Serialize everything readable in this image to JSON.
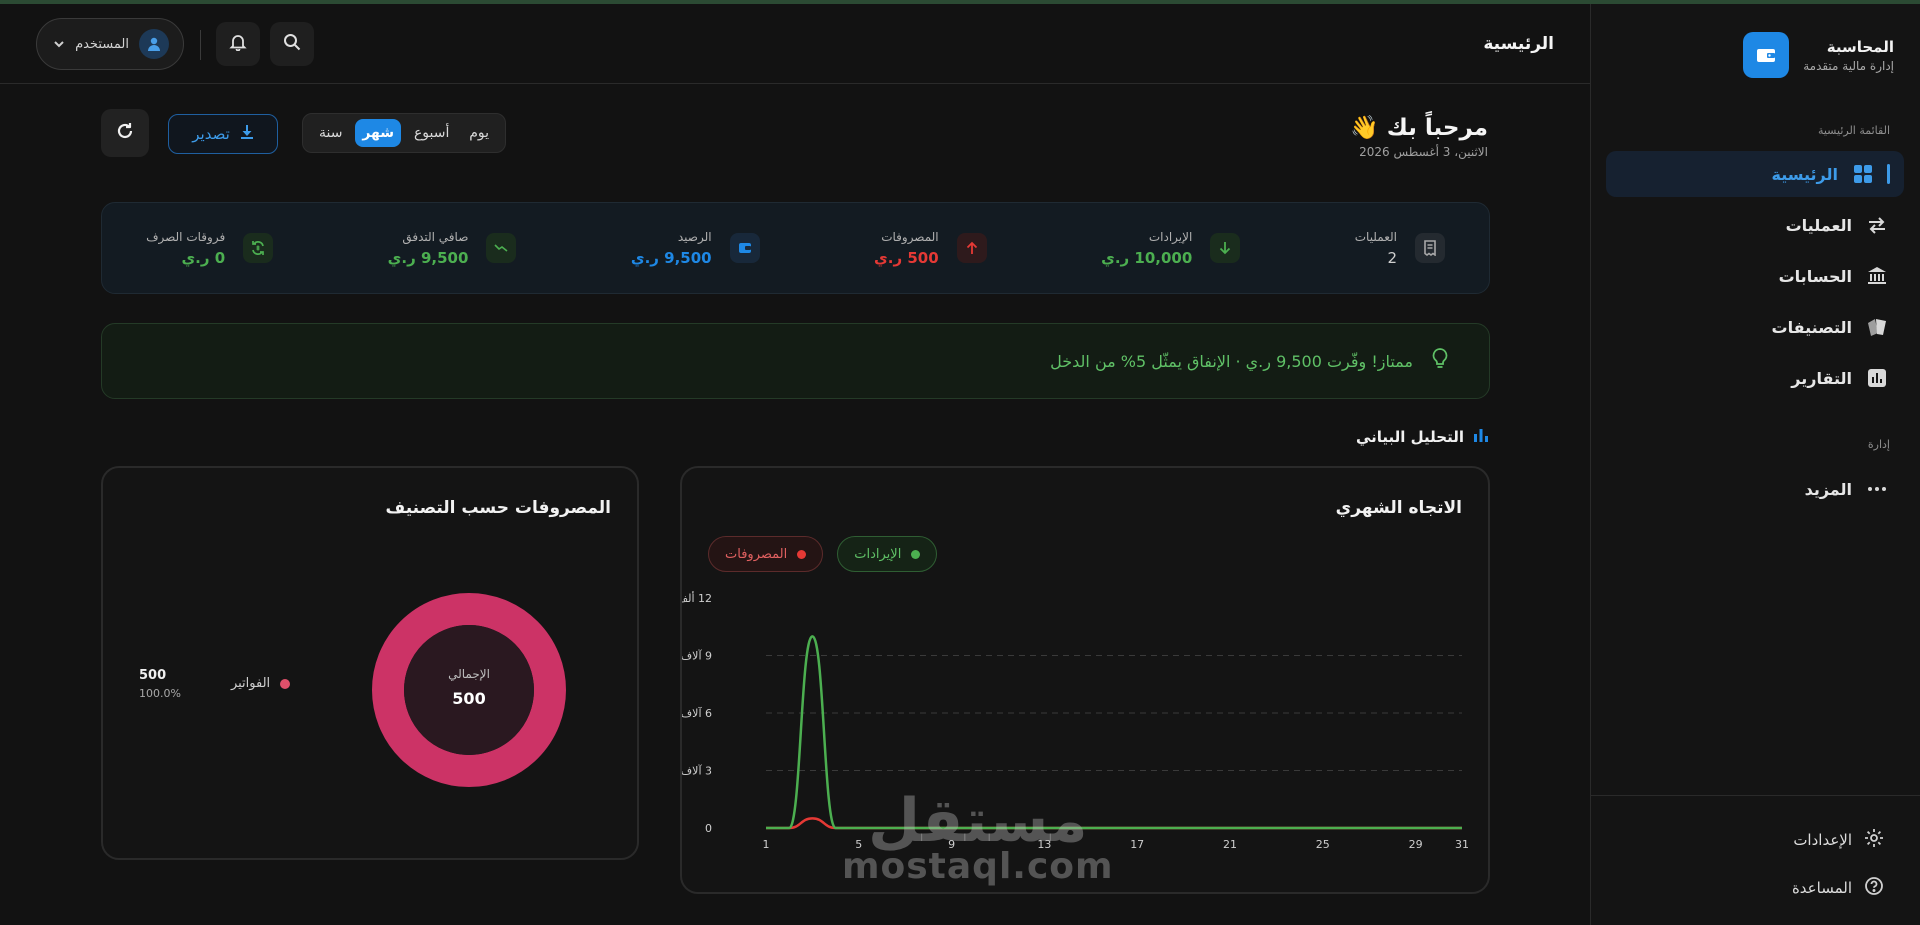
{
  "brand": {
    "title": "المحاسبة",
    "subtitle": "إدارة مالية متقدمة"
  },
  "sidebar": {
    "main_section": "القائمة الرئيسية",
    "items": [
      {
        "label": "الرئيسية",
        "icon": "grid-icon",
        "active": true
      },
      {
        "label": "العمليات",
        "icon": "swap-arrows-icon"
      },
      {
        "label": "الحسابات",
        "icon": "bank-icon"
      },
      {
        "label": "التصنيفات",
        "icon": "tags-icon"
      },
      {
        "label": "التقارير",
        "icon": "bar-chart-icon"
      }
    ],
    "admin_section": "إدارة",
    "more_label": "المزيد",
    "settings_label": "الإعدادات",
    "help_label": "المساعدة"
  },
  "header": {
    "page_title": "الرئيسية",
    "user_label": "المستخدم"
  },
  "welcome": {
    "title": "مرحباً بك 👋",
    "date": "الاثنين، 3 أغسطس 2026"
  },
  "period": {
    "options": [
      "يوم",
      "أسبوع",
      "شهر",
      "سنة"
    ],
    "selected": "شهر"
  },
  "actions": {
    "export_label": "تصدير"
  },
  "stats": [
    {
      "label": "العمليات",
      "value": "2",
      "color": "#cfcfcf",
      "icon": "receipt-icon"
    },
    {
      "label": "الإيرادات",
      "value": "10,000 ر.ي",
      "color": "#4caf50",
      "icon": "arrow-down-icon"
    },
    {
      "label": "المصروفات",
      "value": "500 ر.ي",
      "color": "#e53935",
      "icon": "arrow-up-icon"
    },
    {
      "label": "الرصيد",
      "value": "9,500 ر.ي",
      "color": "#1e88e5",
      "icon": "wallet-icon"
    },
    {
      "label": "صافي التدفق",
      "value": "9,500 ر.ي",
      "color": "#4caf50",
      "icon": "trend-icon"
    },
    {
      "label": "فروقات الصرف",
      "value": "0 ر.ي",
      "color": "#4caf50",
      "icon": "exchange-icon"
    }
  ],
  "insight": {
    "text": "ممتاز! وفّرت 9,500 ر.ي · الإنفاق يمثّل 5% من الدخل"
  },
  "analytics": {
    "section_title": "التحليل البياني"
  },
  "chart_data": [
    {
      "type": "line",
      "title": "الاتجاه الشهري",
      "x": [
        1,
        2,
        3,
        4,
        5,
        6,
        7,
        8,
        9,
        10,
        11,
        12,
        13,
        14,
        15,
        16,
        17,
        18,
        19,
        20,
        21,
        22,
        23,
        24,
        25,
        26,
        27,
        28,
        29,
        30,
        31
      ],
      "x_tick_labels": [
        "1",
        "5",
        "9",
        "13",
        "17",
        "21",
        "25",
        "29",
        "31"
      ],
      "y_tick_labels": [
        "0",
        "3 آلاف",
        "6 آلاف",
        "9 آلاف",
        "12 ألف"
      ],
      "ylim": [
        0,
        12000
      ],
      "series": [
        {
          "name": "الإيرادات",
          "color": "#4caf50",
          "values": [
            0,
            0,
            10000,
            0,
            0,
            0,
            0,
            0,
            0,
            0,
            0,
            0,
            0,
            0,
            0,
            0,
            0,
            0,
            0,
            0,
            0,
            0,
            0,
            0,
            0,
            0,
            0,
            0,
            0,
            0,
            0
          ]
        },
        {
          "name": "المصروفات",
          "color": "#e53935",
          "values": [
            0,
            0,
            500,
            0,
            0,
            0,
            0,
            0,
            0,
            0,
            0,
            0,
            0,
            0,
            0,
            0,
            0,
            0,
            0,
            0,
            0,
            0,
            0,
            0,
            0,
            0,
            0,
            0,
            0,
            0,
            0
          ]
        }
      ],
      "grid": true
    },
    {
      "type": "pie",
      "title": "المصروفات حسب التصنيف",
      "center_label": "الإجمالي",
      "center_value": "500",
      "slices": [
        {
          "name": "الفواتير",
          "value": 500,
          "value_label": "500",
          "percent": "100.0%",
          "color": "#cc3366"
        }
      ]
    }
  ],
  "watermark": {
    "arabic": "مستقل",
    "latin": "mostaql.com"
  }
}
